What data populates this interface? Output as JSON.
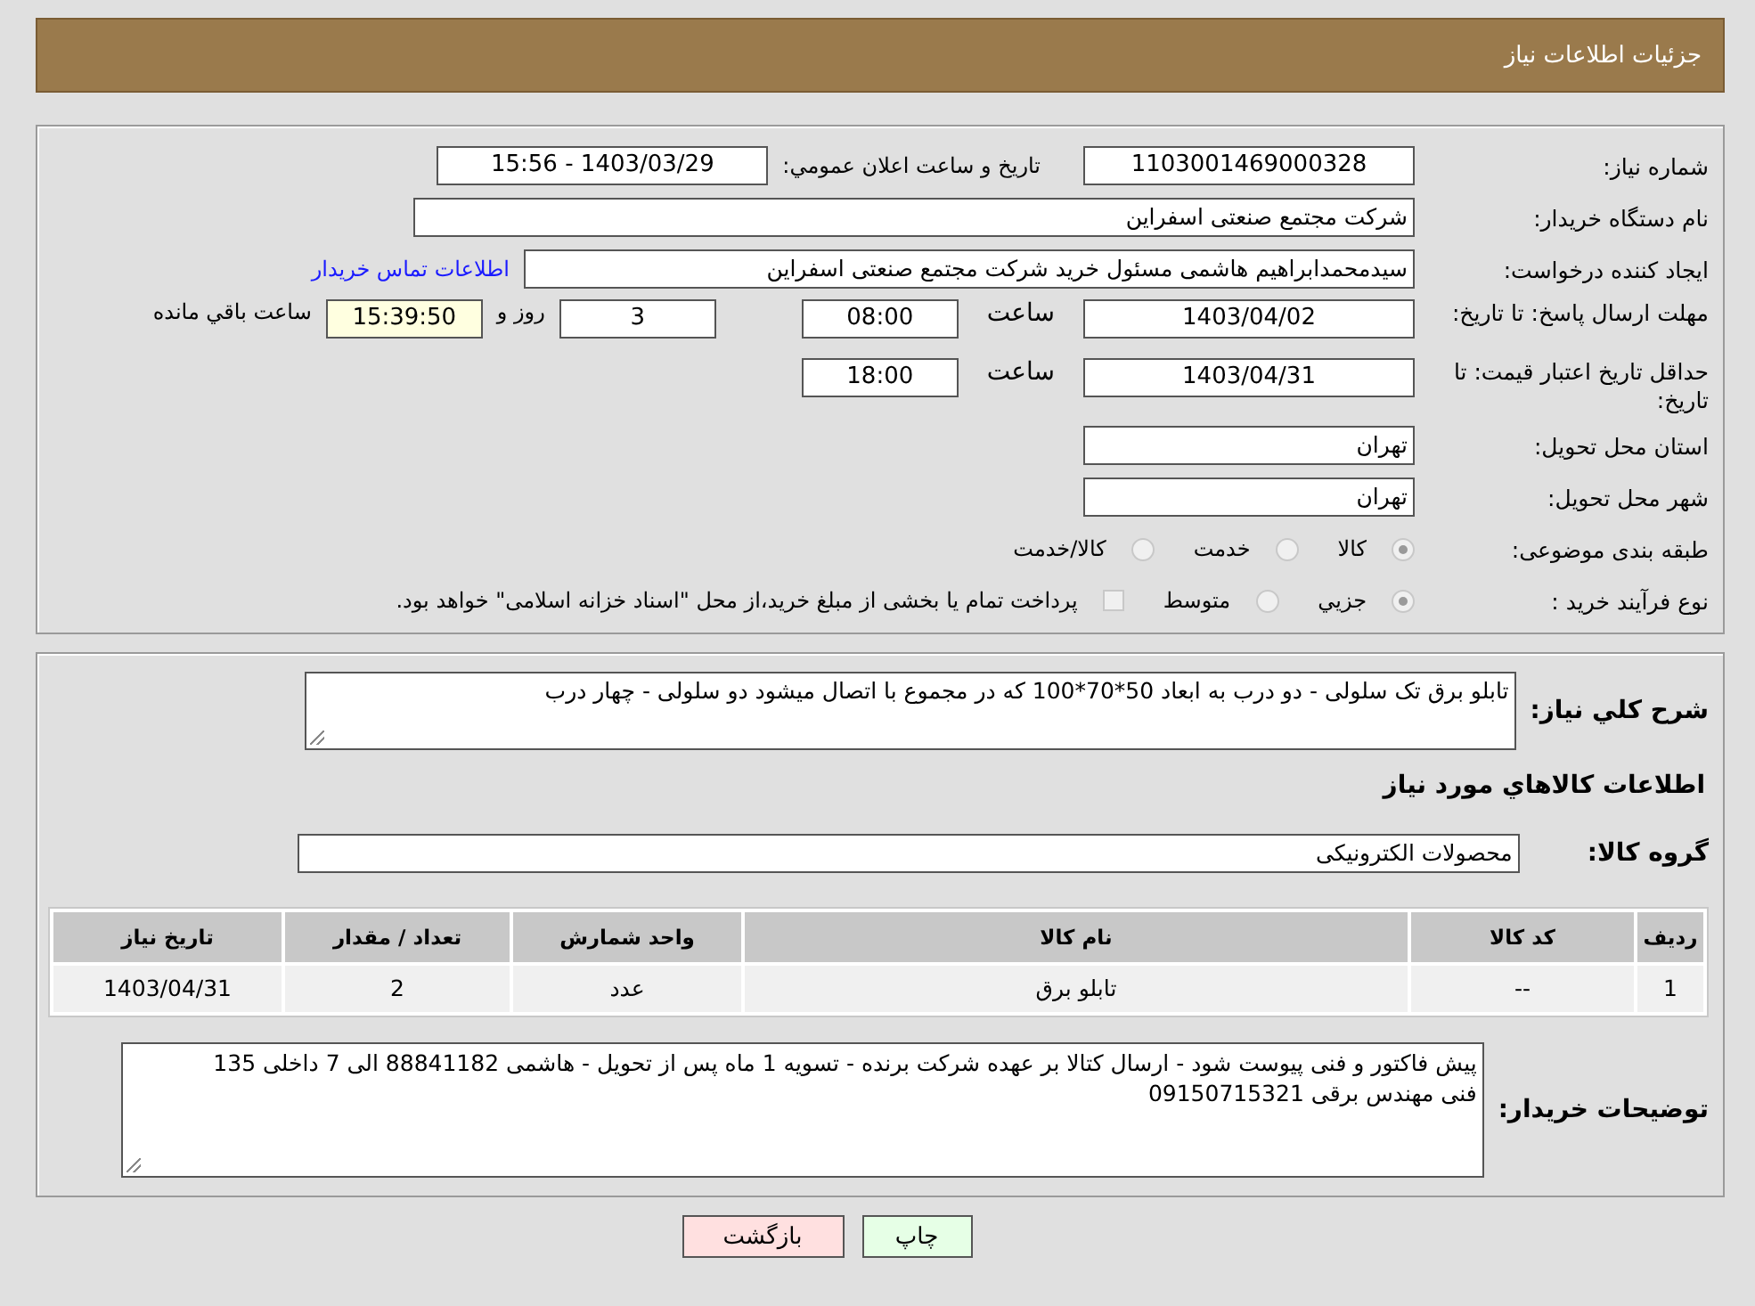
{
  "header": {
    "title": "جزئیات اطلاعات نیاز"
  },
  "need_number": {
    "label": "شماره نیاز:",
    "value": "1103001469000328"
  },
  "announce": {
    "label": "تاریخ و ساعت اعلان عمومي:",
    "value": "1403/03/29 - 15:56"
  },
  "buyer": {
    "label": "نام دستگاه خریدار:",
    "value": "شرکت مجتمع صنعتی اسفراین"
  },
  "creator": {
    "label": "ایجاد کننده درخواست:",
    "value": "سیدمحمدابراهیم هاشمی مسئول خرید شرکت مجتمع صنعتی اسفراین",
    "link": "اطلاعات تماس خریدار"
  },
  "reply_deadline": {
    "label": "مهلت ارسال پاسخ: تا تاریخ:",
    "date": "1403/04/02",
    "time_label": "ساعت",
    "time": "08:00",
    "days": "3",
    "days_label": "روز و",
    "remaining": "15:39:50",
    "remaining_label": "ساعت باقي مانده"
  },
  "price_validity": {
    "label": "حداقل تاریخ اعتبار قیمت: تا تاریخ:",
    "date": "1403/04/31",
    "time_label": "ساعت",
    "time": "18:00"
  },
  "province": {
    "label": "استان محل تحویل:",
    "value": "تهران"
  },
  "city": {
    "label": "شهر محل تحویل:",
    "value": "تهران"
  },
  "category": {
    "label": "طبقه بندی موضوعی:",
    "options": [
      {
        "label": "کالا",
        "selected": true
      },
      {
        "label": "خدمت",
        "selected": false
      },
      {
        "label": "کالا/خدمت",
        "selected": false
      }
    ]
  },
  "purchase_type": {
    "label": "نوع فرآیند خرید :",
    "options": [
      {
        "label": "جزيي",
        "selected": true
      },
      {
        "label": "متوسط",
        "selected": false
      }
    ],
    "payment_note": {
      "checked": false,
      "text": "پرداخت تمام یا بخشی از مبلغ خرید،از محل \"اسناد خزانه اسلامی\" خواهد بود."
    }
  },
  "description": {
    "label": "شرح كلي نياز:",
    "value": "تابلو برق تک سلولی - دو درب به ابعاد 50*70*100 که در مجموع با اتصال میشود دو سلولی - چهار درب"
  },
  "goods_title": "اطلاعات كالاهاي مورد نياز",
  "goods_group": {
    "label": "گروه کالا:",
    "value": "محصولات الکترونیکی"
  },
  "table": {
    "columns": [
      "ردیف",
      "کد کالا",
      "نام کالا",
      "واحد شمارش",
      "تعداد / مقدار",
      "تاریخ نیاز"
    ],
    "rows": [
      [
        "1",
        "--",
        "تابلو برق",
        "عدد",
        "2",
        "1403/04/31"
      ]
    ]
  },
  "buyer_notes": {
    "label": "توضیحات خریدار:",
    "lines": [
      "پیش فاکتور و فنی پیوست شود - ارسال کتالا بر عهده شرکت برنده - تسویه 1 ماه پس از تحویل - هاشمی 88841182 الی 7 داخلی 135",
      "فنی مهندس برقی 09150715321"
    ]
  },
  "buttons": [
    {
      "label": "چاپ",
      "kind": "print"
    },
    {
      "label": "بازگشت",
      "kind": "back"
    }
  ]
}
